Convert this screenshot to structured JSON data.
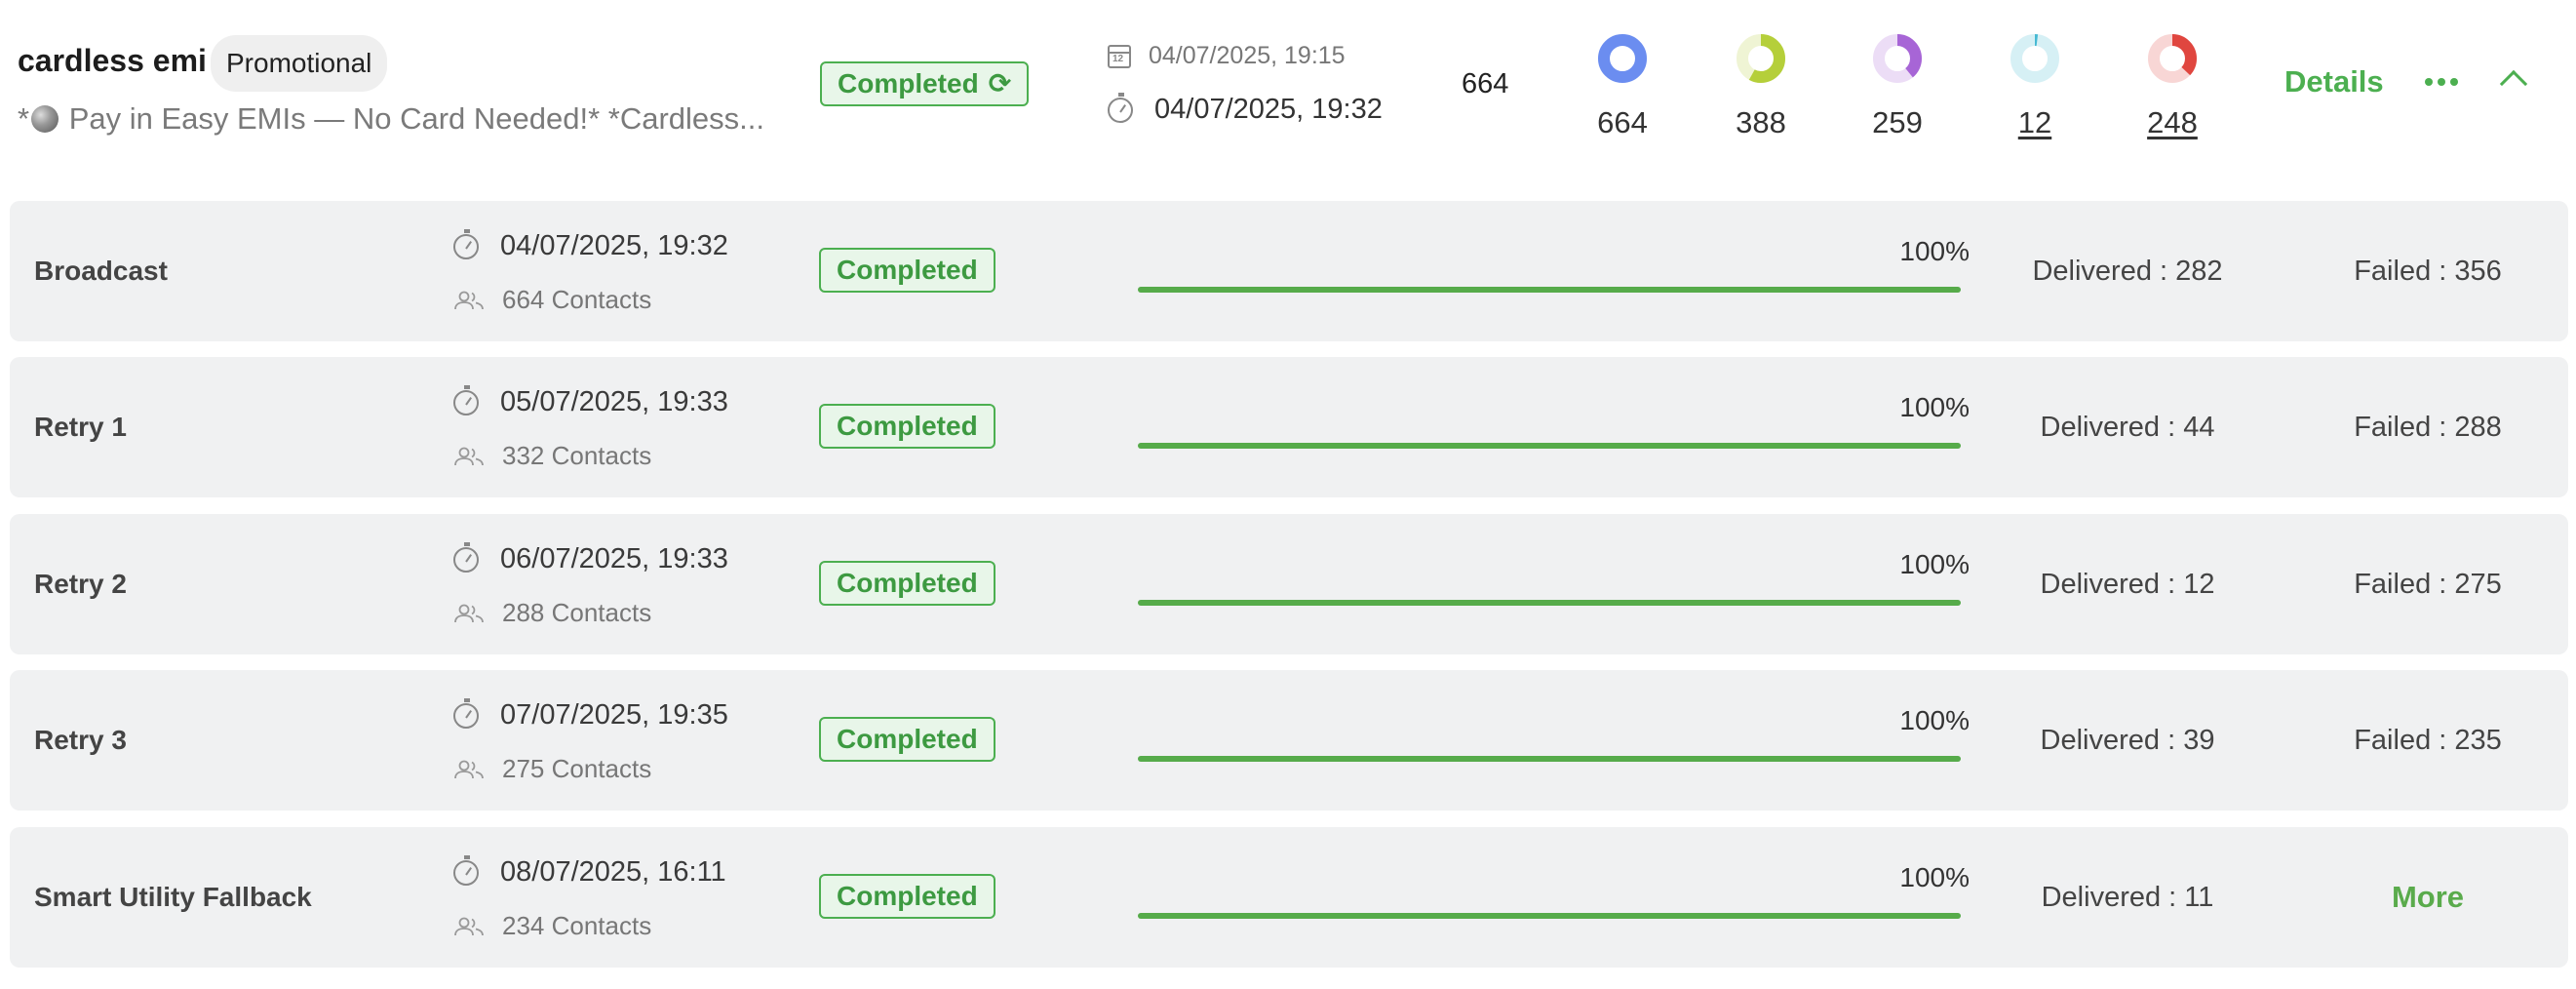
{
  "campaign": {
    "name": "cardless emi",
    "tag": "Promotional",
    "message_prefix": "*",
    "message": " Pay in Easy EMIs — No Card Needed!* *Cardless...",
    "status": "Completed",
    "scheduled_at": "04/07/2025, 19:15",
    "completed_at": "04/07/2025, 19:32",
    "audience_count": "664"
  },
  "stats": [
    {
      "value": "664",
      "color": "#6b8df0",
      "fraction": 1.0,
      "underlined": false
    },
    {
      "value": "388",
      "color": "#b5cf3a",
      "fraction": 0.58,
      "underlined": false
    },
    {
      "value": "259",
      "color": "#a765d6",
      "fraction": 0.39,
      "underlined": false
    },
    {
      "value": "12",
      "color": "#46b9d3",
      "fraction": 0.02,
      "underlined": true
    },
    {
      "value": "248",
      "color": "#e0463f",
      "fraction": 0.37,
      "underlined": true
    }
  ],
  "actions": {
    "details": "Details"
  },
  "runs": [
    {
      "name": "Broadcast",
      "time": "04/07/2025, 19:32",
      "contacts": "664 Contacts",
      "status": "Completed",
      "progress_label": "100%",
      "progress": 1.0,
      "delivered": "Delivered : 282",
      "failed": "Failed : 356"
    },
    {
      "name": "Retry 1",
      "time": "05/07/2025, 19:33",
      "contacts": "332 Contacts",
      "status": "Completed",
      "progress_label": "100%",
      "progress": 1.0,
      "delivered": "Delivered : 44",
      "failed": "Failed : 288"
    },
    {
      "name": "Retry 2",
      "time": "06/07/2025, 19:33",
      "contacts": "288 Contacts",
      "status": "Completed",
      "progress_label": "100%",
      "progress": 1.0,
      "delivered": "Delivered : 12",
      "failed": "Failed : 275"
    },
    {
      "name": "Retry 3",
      "time": "07/07/2025, 19:35",
      "contacts": "275 Contacts",
      "status": "Completed",
      "progress_label": "100%",
      "progress": 1.0,
      "delivered": "Delivered : 39",
      "failed": "Failed : 235"
    },
    {
      "name": "Smart Utility Fallback",
      "time": "08/07/2025, 16:11",
      "contacts": "234 Contacts",
      "status": "Completed",
      "progress_label": "100%",
      "progress": 1.0,
      "delivered": "Delivered : 11",
      "failed": "More"
    }
  ],
  "colors": {
    "accent_green": "#4caf50",
    "status_bg": "#e8f6e9",
    "row_bg": "#f0f1f2"
  }
}
